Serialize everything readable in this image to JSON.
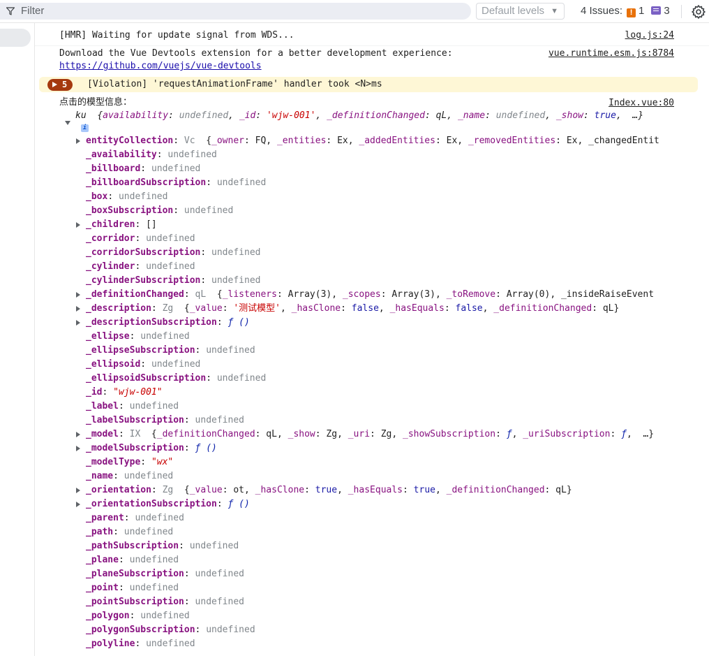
{
  "toolbar": {
    "filter_label": "Filter",
    "levels_label": "Default levels",
    "issues_label": "4 Issues:",
    "issues_warn_count": "1",
    "issues_info_count": "3"
  },
  "messages": {
    "hmr": {
      "text": "[HMR] Waiting for update signal from WDS...",
      "source": "log.js:24"
    },
    "devtools": {
      "text": "Download the Vue Devtools extension for a better development experience:",
      "link": "https://github.com/vuejs/vue-devtools",
      "source": "vue.runtime.esm.js:8784"
    },
    "violation": {
      "count": "5",
      "text": "[Violation] 'requestAnimationFrame' handler took <N>ms"
    },
    "model_log": {
      "label": "点击的模型信息：",
      "source": "Index.vue:80"
    }
  },
  "object": {
    "class_name": "ku",
    "preview": "{availability: undefined, _id: 'wjw-001', _definitionChanged: qL, _name: undefined, _show: true,  …}",
    "info_icon": "i"
  },
  "properties": [
    {
      "key": "entityCollection",
      "expandable": true,
      "value_type": "obj",
      "value": "Vc  {_owner: FQ, _entities: Ex, _addedEntities: Ex, _removedEntities: Ex, _changedEntit"
    },
    {
      "key": "_availability",
      "expandable": false,
      "value_type": "undef",
      "value": "undefined"
    },
    {
      "key": "_billboard",
      "expandable": false,
      "value_type": "undef",
      "value": "undefined"
    },
    {
      "key": "_billboardSubscription",
      "expandable": false,
      "value_type": "undef",
      "value": "undefined"
    },
    {
      "key": "_box",
      "expandable": false,
      "value_type": "undef",
      "value": "undefined"
    },
    {
      "key": "_boxSubscription",
      "expandable": false,
      "value_type": "undef",
      "value": "undefined"
    },
    {
      "key": "_children",
      "expandable": true,
      "value_type": "plain",
      "value": "[]"
    },
    {
      "key": "_corridor",
      "expandable": false,
      "value_type": "undef",
      "value": "undefined"
    },
    {
      "key": "_corridorSubscription",
      "expandable": false,
      "value_type": "undef",
      "value": "undefined"
    },
    {
      "key": "_cylinder",
      "expandable": false,
      "value_type": "undef",
      "value": "undefined"
    },
    {
      "key": "_cylinderSubscription",
      "expandable": false,
      "value_type": "undef",
      "value": "undefined"
    },
    {
      "key": "_definitionChanged",
      "expandable": true,
      "value_type": "obj",
      "value": "qL  {_listeners: Array(3), _scopes: Array(3), _toRemove: Array(0), _insideRaiseEvent"
    },
    {
      "key": "_description",
      "expandable": true,
      "value_type": "obj",
      "value": "Zg  {_value: '测试模型', _hasClone: false, _hasEquals: false, _definitionChanged: qL}"
    },
    {
      "key": "_descriptionSubscription",
      "expandable": true,
      "value_type": "fn",
      "value": "ƒ ()"
    },
    {
      "key": "_ellipse",
      "expandable": false,
      "value_type": "undef",
      "value": "undefined"
    },
    {
      "key": "_ellipseSubscription",
      "expandable": false,
      "value_type": "undef",
      "value": "undefined"
    },
    {
      "key": "_ellipsoid",
      "expandable": false,
      "value_type": "undef",
      "value": "undefined"
    },
    {
      "key": "_ellipsoidSubscription",
      "expandable": false,
      "value_type": "undef",
      "value": "undefined"
    },
    {
      "key": "_id",
      "expandable": false,
      "value_type": "str",
      "value": "\"wjw-001\""
    },
    {
      "key": "_label",
      "expandable": false,
      "value_type": "undef",
      "value": "undefined"
    },
    {
      "key": "_labelSubscription",
      "expandable": false,
      "value_type": "undef",
      "value": "undefined"
    },
    {
      "key": "_model",
      "expandable": true,
      "value_type": "obj",
      "value": "IX  {_definitionChanged: qL, _show: Zg, _uri: Zg, _showSubscription: ƒ, _uriSubscription: ƒ,  …}"
    },
    {
      "key": "_modelSubscription",
      "expandable": true,
      "value_type": "fn",
      "value": "ƒ ()"
    },
    {
      "key": "_modelType",
      "expandable": false,
      "value_type": "str",
      "value": "\"wx\""
    },
    {
      "key": "_name",
      "expandable": false,
      "value_type": "undef",
      "value": "undefined"
    },
    {
      "key": "_orientation",
      "expandable": true,
      "value_type": "obj",
      "value": "Zg  {_value: ot, _hasClone: true, _hasEquals: true, _definitionChanged: qL}"
    },
    {
      "key": "_orientationSubscription",
      "expandable": true,
      "value_type": "fn",
      "value": "ƒ ()"
    },
    {
      "key": "_parent",
      "expandable": false,
      "value_type": "undef",
      "value": "undefined"
    },
    {
      "key": "_path",
      "expandable": false,
      "value_type": "undef",
      "value": "undefined"
    },
    {
      "key": "_pathSubscription",
      "expandable": false,
      "value_type": "undef",
      "value": "undefined"
    },
    {
      "key": "_plane",
      "expandable": false,
      "value_type": "undef",
      "value": "undefined"
    },
    {
      "key": "_planeSubscription",
      "expandable": false,
      "value_type": "undef",
      "value": "undefined"
    },
    {
      "key": "_point",
      "expandable": false,
      "value_type": "undef",
      "value": "undefined"
    },
    {
      "key": "_pointSubscription",
      "expandable": false,
      "value_type": "undef",
      "value": "undefined"
    },
    {
      "key": "_polygon",
      "expandable": false,
      "value_type": "undef",
      "value": "undefined"
    },
    {
      "key": "_polygonSubscription",
      "expandable": false,
      "value_type": "undef",
      "value": "undefined"
    },
    {
      "key": "_polyline",
      "expandable": false,
      "value_type": "undef",
      "value": "undefined"
    }
  ]
}
